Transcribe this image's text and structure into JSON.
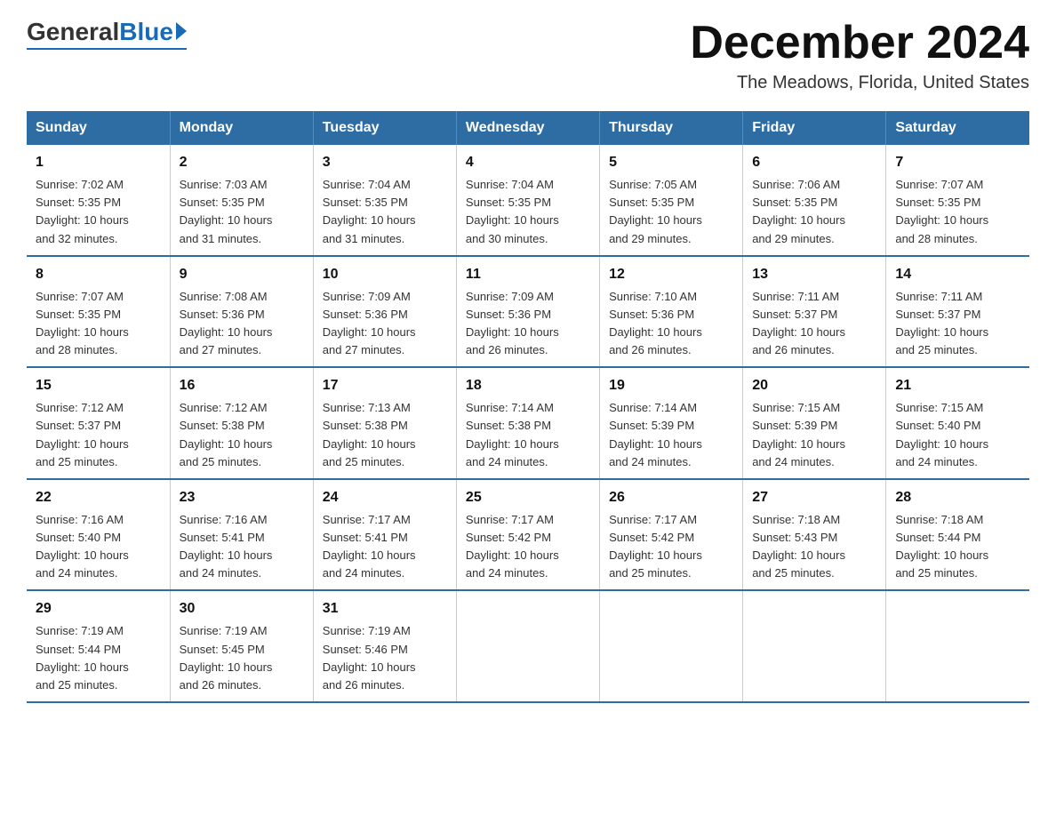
{
  "logo": {
    "general": "General",
    "blue": "Blue",
    "tagline": "Blue"
  },
  "title": "December 2024",
  "subtitle": "The Meadows, Florida, United States",
  "days_of_week": [
    "Sunday",
    "Monday",
    "Tuesday",
    "Wednesday",
    "Thursday",
    "Friday",
    "Saturday"
  ],
  "weeks": [
    [
      {
        "day": "1",
        "sunrise": "7:02 AM",
        "sunset": "5:35 PM",
        "daylight": "10 hours and 32 minutes."
      },
      {
        "day": "2",
        "sunrise": "7:03 AM",
        "sunset": "5:35 PM",
        "daylight": "10 hours and 31 minutes."
      },
      {
        "day": "3",
        "sunrise": "7:04 AM",
        "sunset": "5:35 PM",
        "daylight": "10 hours and 31 minutes."
      },
      {
        "day": "4",
        "sunrise": "7:04 AM",
        "sunset": "5:35 PM",
        "daylight": "10 hours and 30 minutes."
      },
      {
        "day": "5",
        "sunrise": "7:05 AM",
        "sunset": "5:35 PM",
        "daylight": "10 hours and 29 minutes."
      },
      {
        "day": "6",
        "sunrise": "7:06 AM",
        "sunset": "5:35 PM",
        "daylight": "10 hours and 29 minutes."
      },
      {
        "day": "7",
        "sunrise": "7:07 AM",
        "sunset": "5:35 PM",
        "daylight": "10 hours and 28 minutes."
      }
    ],
    [
      {
        "day": "8",
        "sunrise": "7:07 AM",
        "sunset": "5:35 PM",
        "daylight": "10 hours and 28 minutes."
      },
      {
        "day": "9",
        "sunrise": "7:08 AM",
        "sunset": "5:36 PM",
        "daylight": "10 hours and 27 minutes."
      },
      {
        "day": "10",
        "sunrise": "7:09 AM",
        "sunset": "5:36 PM",
        "daylight": "10 hours and 27 minutes."
      },
      {
        "day": "11",
        "sunrise": "7:09 AM",
        "sunset": "5:36 PM",
        "daylight": "10 hours and 26 minutes."
      },
      {
        "day": "12",
        "sunrise": "7:10 AM",
        "sunset": "5:36 PM",
        "daylight": "10 hours and 26 minutes."
      },
      {
        "day": "13",
        "sunrise": "7:11 AM",
        "sunset": "5:37 PM",
        "daylight": "10 hours and 26 minutes."
      },
      {
        "day": "14",
        "sunrise": "7:11 AM",
        "sunset": "5:37 PM",
        "daylight": "10 hours and 25 minutes."
      }
    ],
    [
      {
        "day": "15",
        "sunrise": "7:12 AM",
        "sunset": "5:37 PM",
        "daylight": "10 hours and 25 minutes."
      },
      {
        "day": "16",
        "sunrise": "7:12 AM",
        "sunset": "5:38 PM",
        "daylight": "10 hours and 25 minutes."
      },
      {
        "day": "17",
        "sunrise": "7:13 AM",
        "sunset": "5:38 PM",
        "daylight": "10 hours and 25 minutes."
      },
      {
        "day": "18",
        "sunrise": "7:14 AM",
        "sunset": "5:38 PM",
        "daylight": "10 hours and 24 minutes."
      },
      {
        "day": "19",
        "sunrise": "7:14 AM",
        "sunset": "5:39 PM",
        "daylight": "10 hours and 24 minutes."
      },
      {
        "day": "20",
        "sunrise": "7:15 AM",
        "sunset": "5:39 PM",
        "daylight": "10 hours and 24 minutes."
      },
      {
        "day": "21",
        "sunrise": "7:15 AM",
        "sunset": "5:40 PM",
        "daylight": "10 hours and 24 minutes."
      }
    ],
    [
      {
        "day": "22",
        "sunrise": "7:16 AM",
        "sunset": "5:40 PM",
        "daylight": "10 hours and 24 minutes."
      },
      {
        "day": "23",
        "sunrise": "7:16 AM",
        "sunset": "5:41 PM",
        "daylight": "10 hours and 24 minutes."
      },
      {
        "day": "24",
        "sunrise": "7:17 AM",
        "sunset": "5:41 PM",
        "daylight": "10 hours and 24 minutes."
      },
      {
        "day": "25",
        "sunrise": "7:17 AM",
        "sunset": "5:42 PM",
        "daylight": "10 hours and 24 minutes."
      },
      {
        "day": "26",
        "sunrise": "7:17 AM",
        "sunset": "5:42 PM",
        "daylight": "10 hours and 25 minutes."
      },
      {
        "day": "27",
        "sunrise": "7:18 AM",
        "sunset": "5:43 PM",
        "daylight": "10 hours and 25 minutes."
      },
      {
        "day": "28",
        "sunrise": "7:18 AM",
        "sunset": "5:44 PM",
        "daylight": "10 hours and 25 minutes."
      }
    ],
    [
      {
        "day": "29",
        "sunrise": "7:19 AM",
        "sunset": "5:44 PM",
        "daylight": "10 hours and 25 minutes."
      },
      {
        "day": "30",
        "sunrise": "7:19 AM",
        "sunset": "5:45 PM",
        "daylight": "10 hours and 26 minutes."
      },
      {
        "day": "31",
        "sunrise": "7:19 AM",
        "sunset": "5:46 PM",
        "daylight": "10 hours and 26 minutes."
      },
      null,
      null,
      null,
      null
    ]
  ],
  "labels": {
    "sunrise": "Sunrise:",
    "sunset": "Sunset:",
    "daylight": "Daylight:"
  }
}
